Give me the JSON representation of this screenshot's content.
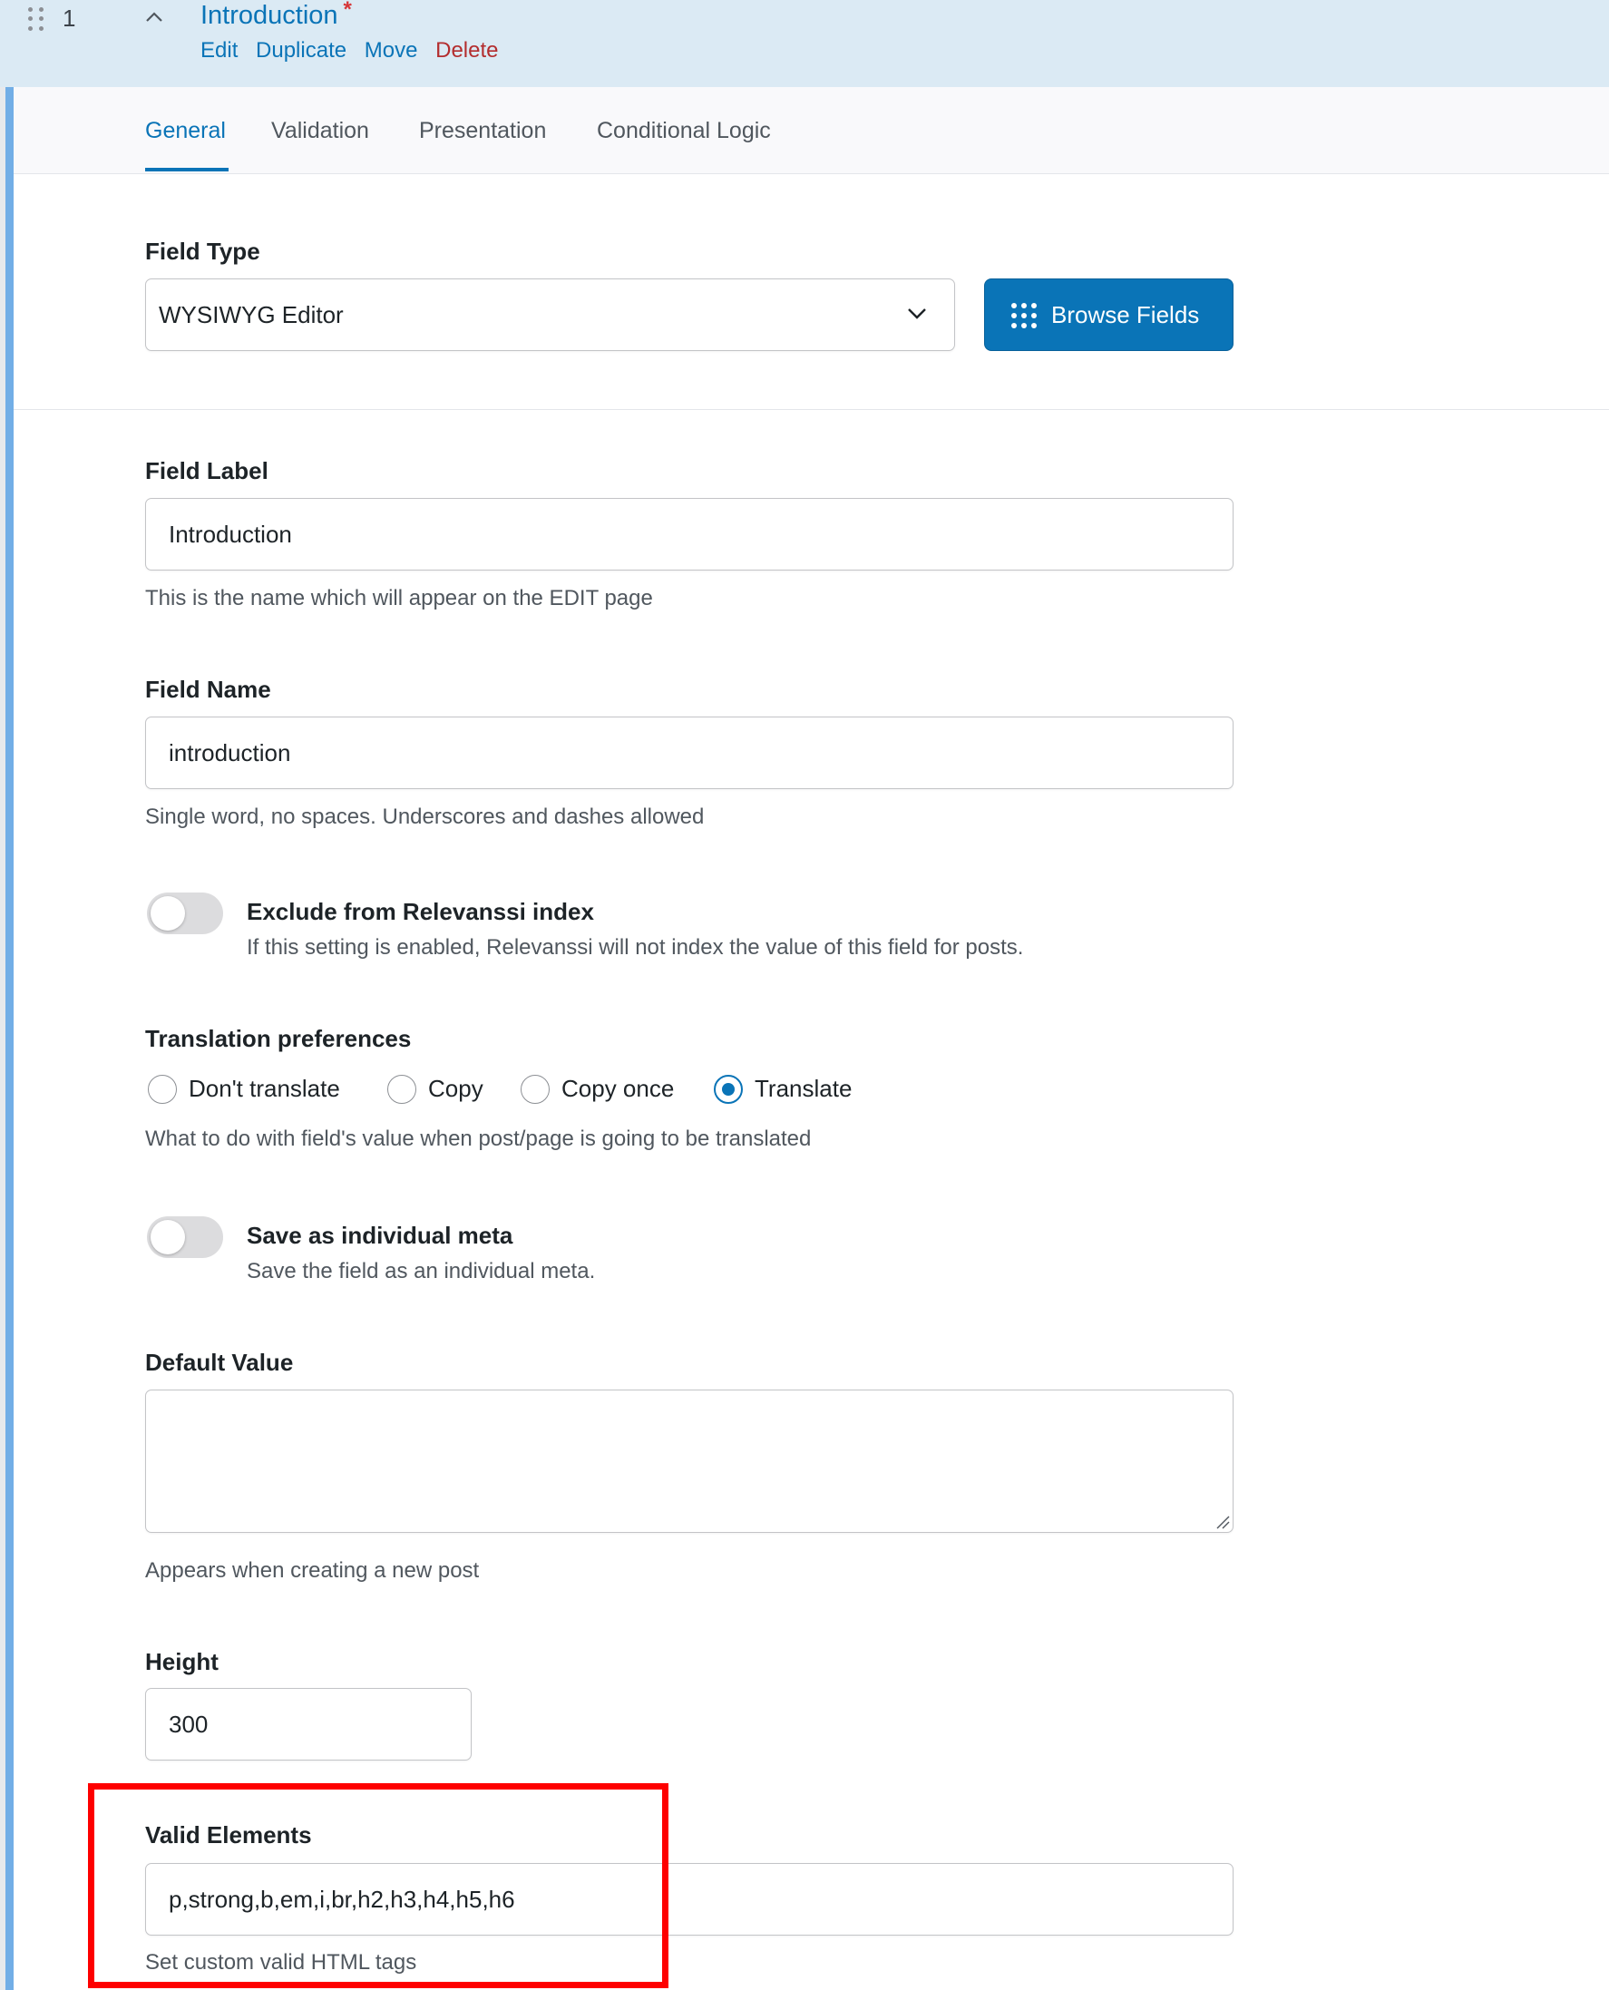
{
  "field": {
    "order": "1",
    "title": "Introduction",
    "required_mark": "*",
    "actions": {
      "edit": "Edit",
      "duplicate": "Duplicate",
      "move": "Move",
      "delete": "Delete"
    }
  },
  "tabs": {
    "general": "General",
    "validation": "Validation",
    "presentation": "Presentation",
    "conditional_logic": "Conditional Logic",
    "active": "General"
  },
  "field_type": {
    "label": "Field Type",
    "value": "WYSIWYG Editor",
    "browse_button": "Browse Fields"
  },
  "field_label": {
    "label": "Field Label",
    "value": "Introduction",
    "help": "This is the name which will appear on the EDIT page"
  },
  "field_name": {
    "label": "Field Name",
    "value": "introduction",
    "help": "Single word, no spaces. Underscores and dashes allowed"
  },
  "relevanssi": {
    "title": "Exclude from Relevanssi index",
    "description": "If this setting is enabled, Relevanssi will not index the value of this field for posts.",
    "enabled": false
  },
  "translation": {
    "label": "Translation preferences",
    "options": [
      "Don't translate",
      "Copy",
      "Copy once",
      "Translate"
    ],
    "selected": "Translate",
    "help": "What to do with field's value when post/page is going to be translated"
  },
  "individual_meta": {
    "title": "Save as individual meta",
    "description": "Save the field as an individual meta.",
    "enabled": false
  },
  "default_value": {
    "label": "Default Value",
    "value": "",
    "help": "Appears when creating a new post"
  },
  "height": {
    "label": "Height",
    "value": "300"
  },
  "valid_elements": {
    "label": "Valid Elements",
    "value": "p,strong,b,em,i,br,h2,h3,h4,h5,h6",
    "help": "Set custom valid HTML tags"
  },
  "colors": {
    "accent": "#0a74b7",
    "delete": "#b32d2e",
    "highlight": "#fe0000",
    "header_bg": "#dbeaf4"
  }
}
